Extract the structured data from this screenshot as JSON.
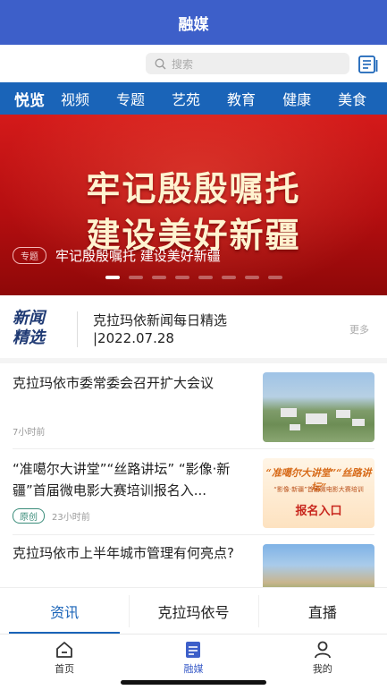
{
  "header": {
    "title": "融媒"
  },
  "search": {
    "placeholder": "搜索"
  },
  "channels": [
    "悦览",
    "视频",
    "专题",
    "艺苑",
    "教育",
    "健康",
    "美食"
  ],
  "banner": {
    "headline_line1": "牢记殷殷嘱托",
    "headline_line2": "建设美好新疆",
    "tag": "专题",
    "caption": "牢记殷殷嘱托 建设美好新疆",
    "slide_count": 8,
    "active_slide": 1
  },
  "news_picks": {
    "logo_line1": "新闻",
    "logo_line2": "精选",
    "text_line1": "克拉玛依新闻每日精选",
    "text_line2": "|2022.07.28",
    "more": "更多"
  },
  "articles": [
    {
      "title": "克拉玛依市委常委会召开扩大会议",
      "tag": "",
      "time": "7小时前"
    },
    {
      "title": "“准噶尔大讲堂”“丝路讲坛” “影像·新疆”首届微电影大赛培训报名入...",
      "tag": "原创",
      "time": "23小时前",
      "thumb_text1": "“准噶尔大讲堂”“丝路讲坛”",
      "thumb_text2": "“影像·新疆”首届微电影大赛培训",
      "thumb_text3": "报名入口"
    },
    {
      "title": "克拉玛依市上半年城市管理有何亮点?",
      "tag": "",
      "time": ""
    }
  ],
  "bottom_tabs": [
    "资讯",
    "克拉玛依号",
    "直播"
  ],
  "nav": [
    {
      "label": "首页",
      "icon": "home-icon"
    },
    {
      "label": "融媒",
      "icon": "media-icon"
    },
    {
      "label": "我的",
      "icon": "person-icon"
    }
  ],
  "colors": {
    "primary": "#3d5fc9",
    "channel_bar": "#1a64b8",
    "banner_red": "#c8161a"
  }
}
